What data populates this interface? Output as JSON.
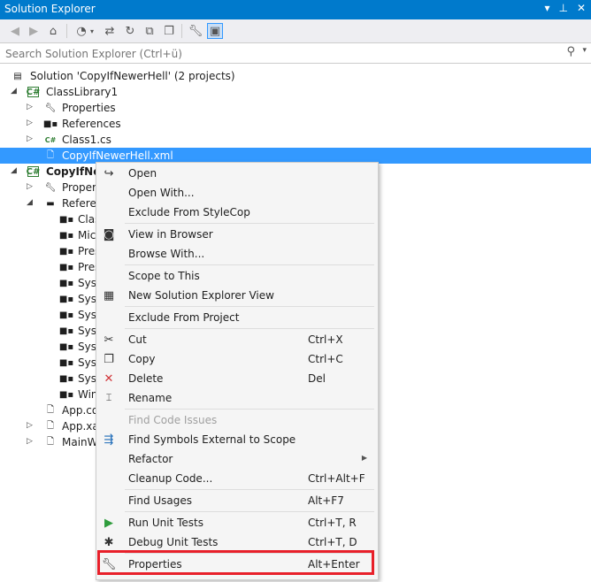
{
  "window": {
    "title": "Solution Explorer",
    "controls": [
      "▾",
      "⊥",
      "✕"
    ]
  },
  "toolbar": {
    "icons": [
      "back-icon",
      "forward-icon",
      "home-icon",
      "history-icon",
      "sync-icon",
      "refresh-icon",
      "collapse-icon",
      "copy-icon",
      "properties-icon",
      "preview-icon"
    ]
  },
  "search": {
    "placeholder": "Search Solution Explorer (Ctrl+ü)",
    "value": ""
  },
  "tree": {
    "solution": "Solution 'CopyIfNewerHell' (2 projects)",
    "project1": "ClassLibrary1",
    "p1_properties": "Properties",
    "p1_references": "References",
    "p1_class1": "Class1.cs",
    "p1_xml": "CopyIfNewerHell.xml",
    "project2": "CopyIfNew",
    "p2_properties": "Propert",
    "p2_references": "Referen",
    "refs": [
      "Clas",
      "Mic",
      "Pres",
      "Pres",
      "Syst",
      "Syst",
      "Syst",
      "Syst",
      "Syst",
      "Syst",
      "Syst",
      "Win"
    ],
    "app_config": "App.co",
    "app_xaml": "App.xa",
    "main_window": "MainW"
  },
  "menu": {
    "items": [
      {
        "label": "Open",
        "shortcut": "",
        "icon": "open-icon"
      },
      {
        "label": "Open With...",
        "shortcut": ""
      },
      {
        "label": "Exclude From StyleCop",
        "shortcut": ""
      },
      {
        "label": "View in Browser",
        "shortcut": "",
        "icon": "browser-icon"
      },
      {
        "label": "Browse With...",
        "shortcut": ""
      },
      {
        "label": "Scope to This",
        "shortcut": ""
      },
      {
        "label": "New Solution Explorer View",
        "shortcut": "",
        "icon": "new-view-icon"
      },
      {
        "label": "Exclude From Project",
        "shortcut": ""
      },
      {
        "label": "Cut",
        "shortcut": "Ctrl+X",
        "icon": "cut-icon"
      },
      {
        "label": "Copy",
        "shortcut": "Ctrl+C",
        "icon": "copy-icon"
      },
      {
        "label": "Delete",
        "shortcut": "Del",
        "icon": "delete-icon"
      },
      {
        "label": "Rename",
        "shortcut": "",
        "icon": "rename-icon"
      },
      {
        "label": "Find Code Issues",
        "shortcut": "",
        "disabled": true
      },
      {
        "label": "Find Symbols External to Scope",
        "shortcut": "",
        "icon": "find-symbols-icon"
      },
      {
        "label": "Refactor",
        "shortcut": "",
        "submenu": true
      },
      {
        "label": "Cleanup Code...",
        "shortcut": "Ctrl+Alt+F"
      },
      {
        "label": "Find Usages",
        "shortcut": "Alt+F7"
      },
      {
        "label": "Run Unit Tests",
        "shortcut": "Ctrl+T, R",
        "icon": "run-icon"
      },
      {
        "label": "Debug Unit Tests",
        "shortcut": "Ctrl+T, D",
        "icon": "debug-icon"
      },
      {
        "label": "Properties",
        "shortcut": "Alt+Enter",
        "icon": "wrench-icon"
      }
    ]
  },
  "colors": {
    "accent": "#007acc",
    "selection": "#3399ff",
    "highlight_box": "#e8202a"
  }
}
